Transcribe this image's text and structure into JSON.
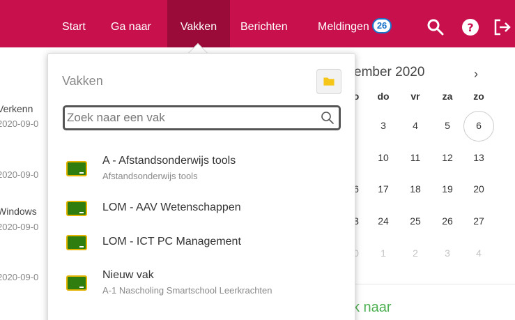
{
  "nav": {
    "items": [
      "Start",
      "Ga naar",
      "Vakken",
      "Berichten",
      "Meldingen"
    ],
    "notification_count": "26",
    "icons": [
      "search-icon",
      "help-icon",
      "logout-icon"
    ],
    "bar_color": "#c8104d",
    "active_color": "#9b0b3a"
  },
  "background": {
    "items": [
      {
        "title": "Verkenn",
        "date": "2020-09-0"
      },
      {
        "title": "",
        "date": "2020-09-0"
      },
      {
        "title": "Windows",
        "date": "2020-09-0"
      },
      {
        "title": "",
        "date": "2020-09-0"
      }
    ],
    "calendar": {
      "title": "ember 2020",
      "next": "›",
      "weekdays": [
        "o",
        "do",
        "vr",
        "za",
        "zo"
      ],
      "rows": [
        [
          "",
          "3",
          "4",
          "5",
          "6"
        ],
        [
          "",
          "10",
          "11",
          "12",
          "13"
        ],
        [
          "6",
          "17",
          "18",
          "19",
          "20"
        ],
        [
          "3",
          "24",
          "25",
          "26",
          "27"
        ],
        [
          "0",
          "1",
          "2",
          "3",
          "4"
        ]
      ],
      "today": "6"
    },
    "link_fragment": "k naar"
  },
  "panel": {
    "title": "Vakken",
    "search_placeholder": "Zoek naar een vak",
    "courses": [
      {
        "title": "A - Afstandsonderwijs tools",
        "subtitle": "Afstandsonderwijs tools"
      },
      {
        "title": "LOM - AAV Wetenschappen",
        "subtitle": ""
      },
      {
        "title": "LOM - ICT PC Management",
        "subtitle": ""
      },
      {
        "title": "Nieuw vak",
        "subtitle": "A-1 Nascholing Smartschool Leerkrachten"
      }
    ],
    "board_colors": {
      "green": "#2e7d0e",
      "frame": "#e3b400"
    }
  }
}
